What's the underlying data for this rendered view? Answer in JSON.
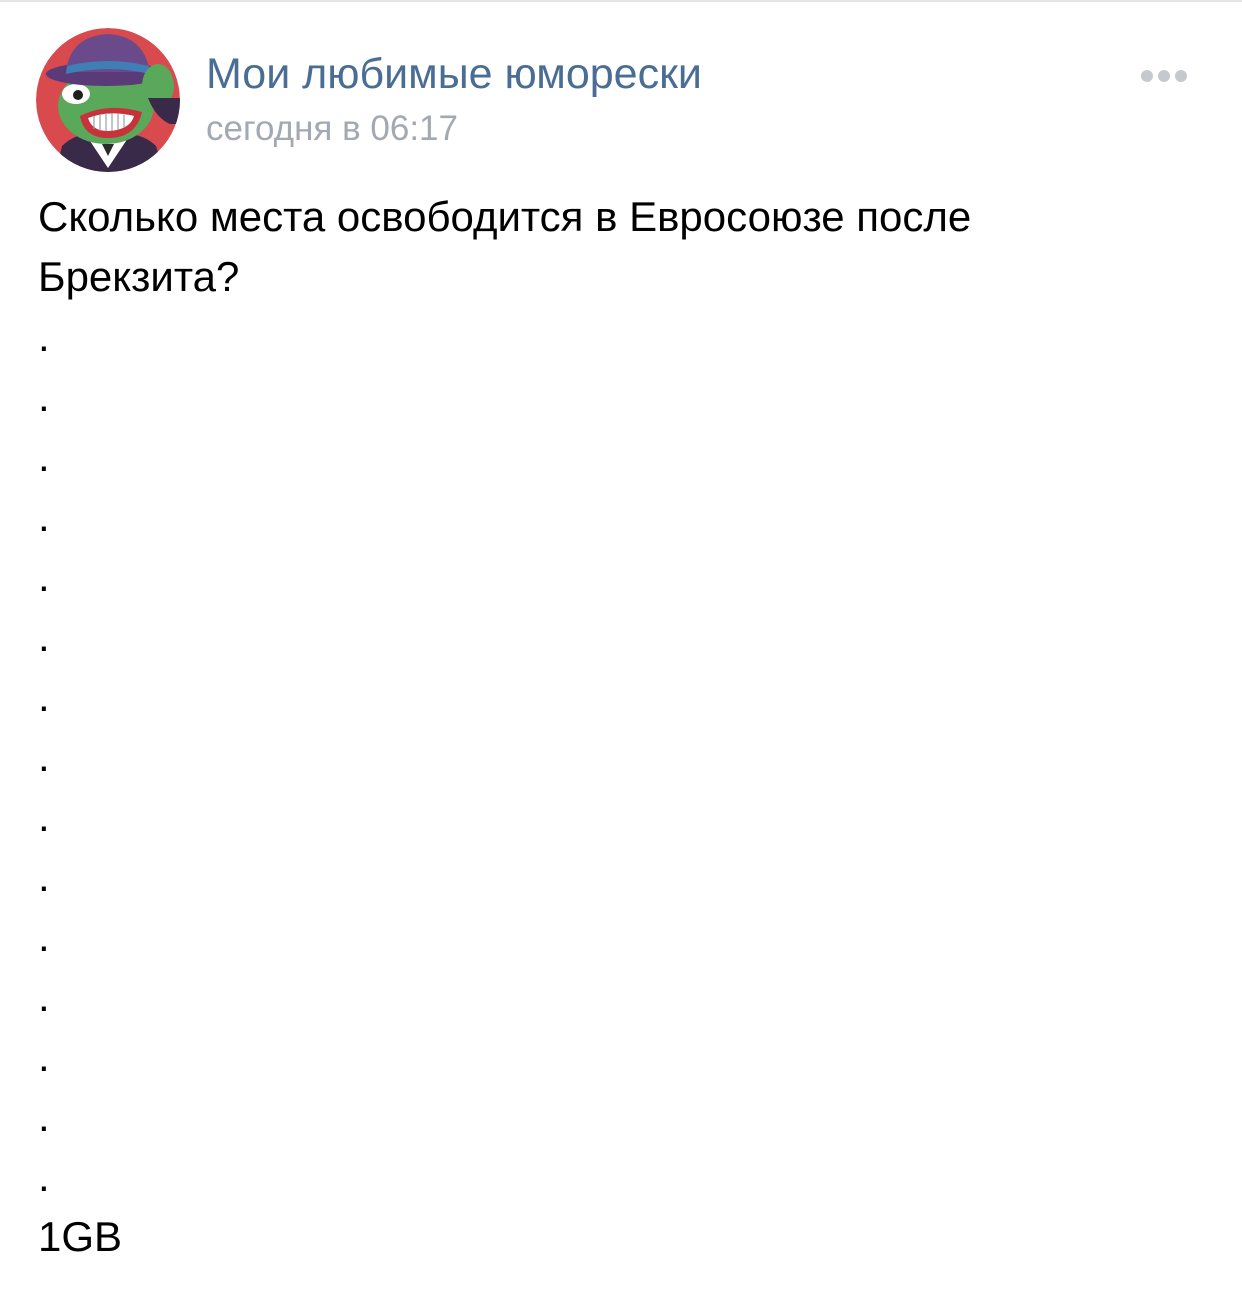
{
  "header": {
    "group_name": "Мои любимые юморески",
    "time": "сегодня в 06:17",
    "more_icon": "more-horizontal-icon",
    "avatar_icon": "group-avatar"
  },
  "post": {
    "lines": [
      "Сколько места освободится в Евросоюзе после",
      "Брекзита?",
      ".",
      ".",
      ".",
      ".",
      ".",
      ".",
      ".",
      ".",
      ".",
      ".",
      ".",
      ".",
      ".",
      ".",
      ".",
      "1GB"
    ]
  },
  "colors": {
    "group_name": "#4a6d95",
    "time": "#a2a9b2",
    "more_dots": "#c5c9ce",
    "avatar_bg": "#d94a4e"
  }
}
